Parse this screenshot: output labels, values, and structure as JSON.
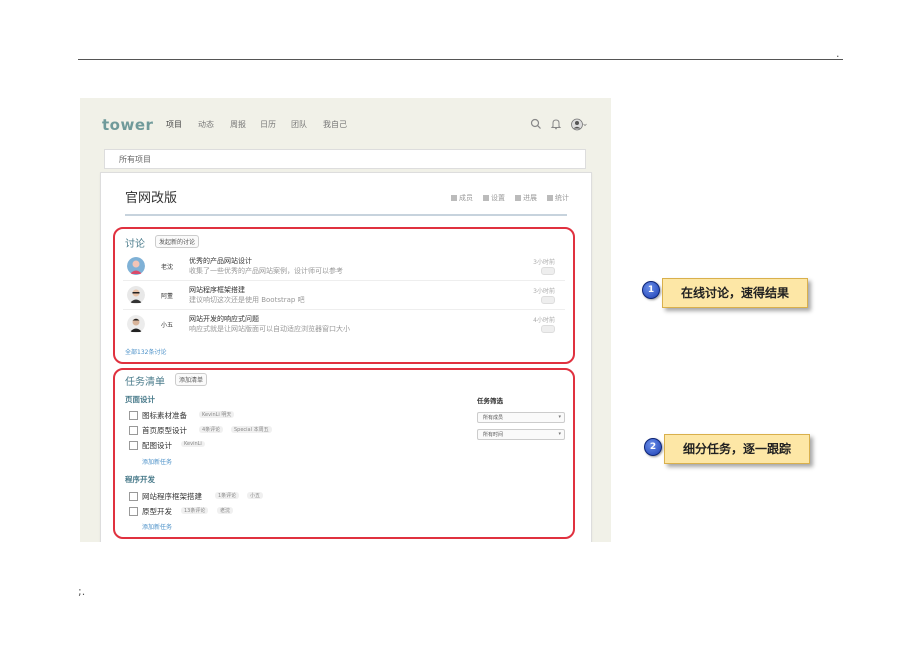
{
  "doc": {
    "dot": ".",
    "footer": ";."
  },
  "app": {
    "logo": "tower",
    "nav": [
      "项目",
      "动态",
      "周报",
      "日历",
      "团队",
      "我自己"
    ],
    "breadcrumb": "所有项目",
    "project_title": "官网改版",
    "project_actions": [
      "成员",
      "设置",
      "进展",
      "统计"
    ]
  },
  "discussions": {
    "title": "讨论",
    "new_button": "发起新的讨论",
    "items": [
      {
        "author": "老沈",
        "title": "优秀的产品网站设计",
        "excerpt": "收集了一些优秀的产品网站案例，设计师可以参考",
        "time": "3小时前"
      },
      {
        "author": "阿董",
        "title": "网站程序框架搭建",
        "excerpt": "建议响切这次还是使用 Bootstrap 吧",
        "time": "3小时前"
      },
      {
        "author": "小五",
        "title": "网站开发的响应式问题",
        "excerpt": "响应式就是让网站版面可以自动适应浏览器窗口大小",
        "time": "4小时前"
      }
    ],
    "all_link": "全部132条讨论"
  },
  "tasks": {
    "title": "任务清单",
    "add_list_button": "添加清单",
    "groups": [
      {
        "name": "页面设计",
        "items": [
          {
            "name": "图标素材准备",
            "tags": [
              "KevinLi 明天"
            ]
          },
          {
            "name": "首页原型设计",
            "tags": [
              "4条评论",
              "Special 本周五"
            ]
          },
          {
            "name": "配图设计",
            "tags": [
              "KevinLi"
            ]
          }
        ],
        "add": "添加新任务"
      },
      {
        "name": "程序开发",
        "items": [
          {
            "name": "网站程序框架搭建",
            "tags": [
              "1条评论",
              "小五"
            ]
          },
          {
            "name": "原型开发",
            "tags": [
              "13条评论",
              "老沈"
            ]
          }
        ],
        "add": "添加新任务"
      }
    ],
    "filter": {
      "title": "任务筛选",
      "member": "所有成员",
      "time": "所有时间"
    }
  },
  "callouts": [
    {
      "num": "1",
      "text": "在线讨论，速得结果"
    },
    {
      "num": "2",
      "text": "细分任务，逐一跟踪"
    }
  ],
  "colors": {
    "highlight": "#e0313f",
    "callout_bg": "#fde7a6",
    "badge": "#1c3fb5",
    "accent": "#4a7b8b"
  }
}
